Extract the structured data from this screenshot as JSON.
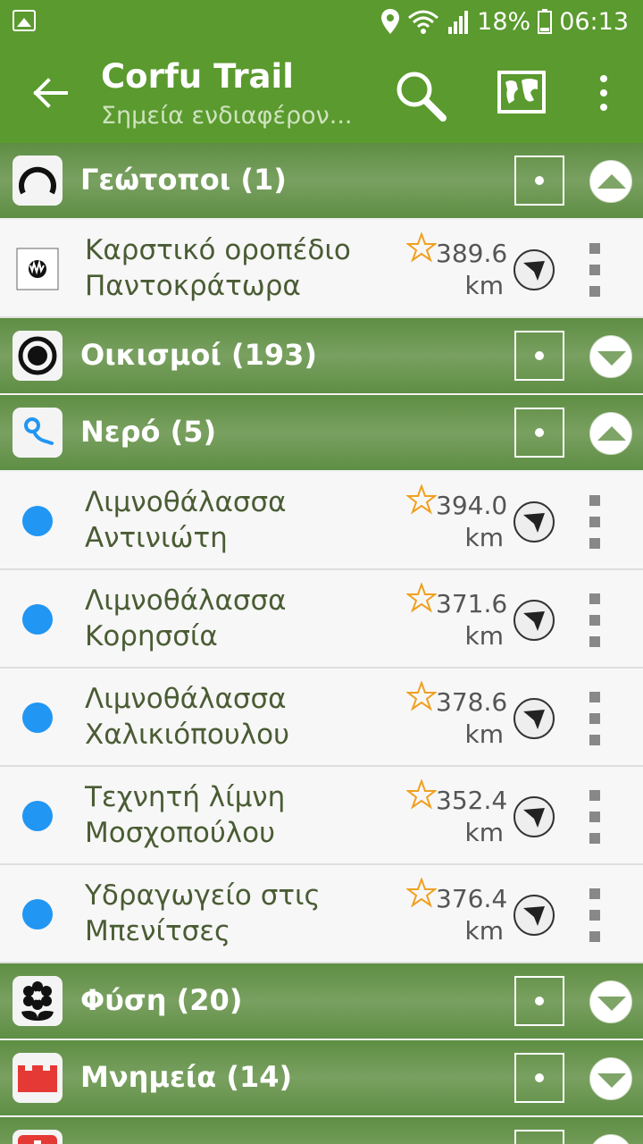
{
  "status": {
    "battery": "18%",
    "time": "06:13"
  },
  "appbar": {
    "title": "Corfu Trail",
    "subtitle": "Σημεία ενδιαφέρον..."
  },
  "categories": [
    {
      "label": "Γεώτοποι (1)",
      "icon": "geotope-icon",
      "expanded": true,
      "items": [
        {
          "name": "Καρστικό οροπέδιο Παντοκράτωρα",
          "distance": "389.6 km"
        }
      ]
    },
    {
      "label": "Οικισμοί (193)",
      "icon": "settlement-icon",
      "expanded": false,
      "items": []
    },
    {
      "label": "Νερό (5)",
      "icon": "water-icon",
      "expanded": true,
      "items": [
        {
          "name": "Λιμνοθάλασσα Αντινιώτη",
          "distance": "394.0 km"
        },
        {
          "name": "Λιμνοθάλασσα Κορησσία",
          "distance": "371.6 km"
        },
        {
          "name": "Λιμνοθάλασσα Χαλικιόπουλου",
          "distance": "378.6 km"
        },
        {
          "name": "Τεχνητή λίμνη Μοσχοπούλου",
          "distance": "352.4 km"
        },
        {
          "name": "Υδραγωγείο στις Μπενίτσες",
          "distance": "376.4 km"
        }
      ]
    },
    {
      "label": "Φύση (20)",
      "icon": "flower-icon",
      "expanded": false,
      "items": []
    },
    {
      "label": "Μνημεία (14)",
      "icon": "castle-icon",
      "expanded": false,
      "items": []
    }
  ],
  "colors": {
    "appbar": "#5a9a2e",
    "category_bar": "#6c9651",
    "water_dot": "#2196f3",
    "star": "#f0a020"
  }
}
